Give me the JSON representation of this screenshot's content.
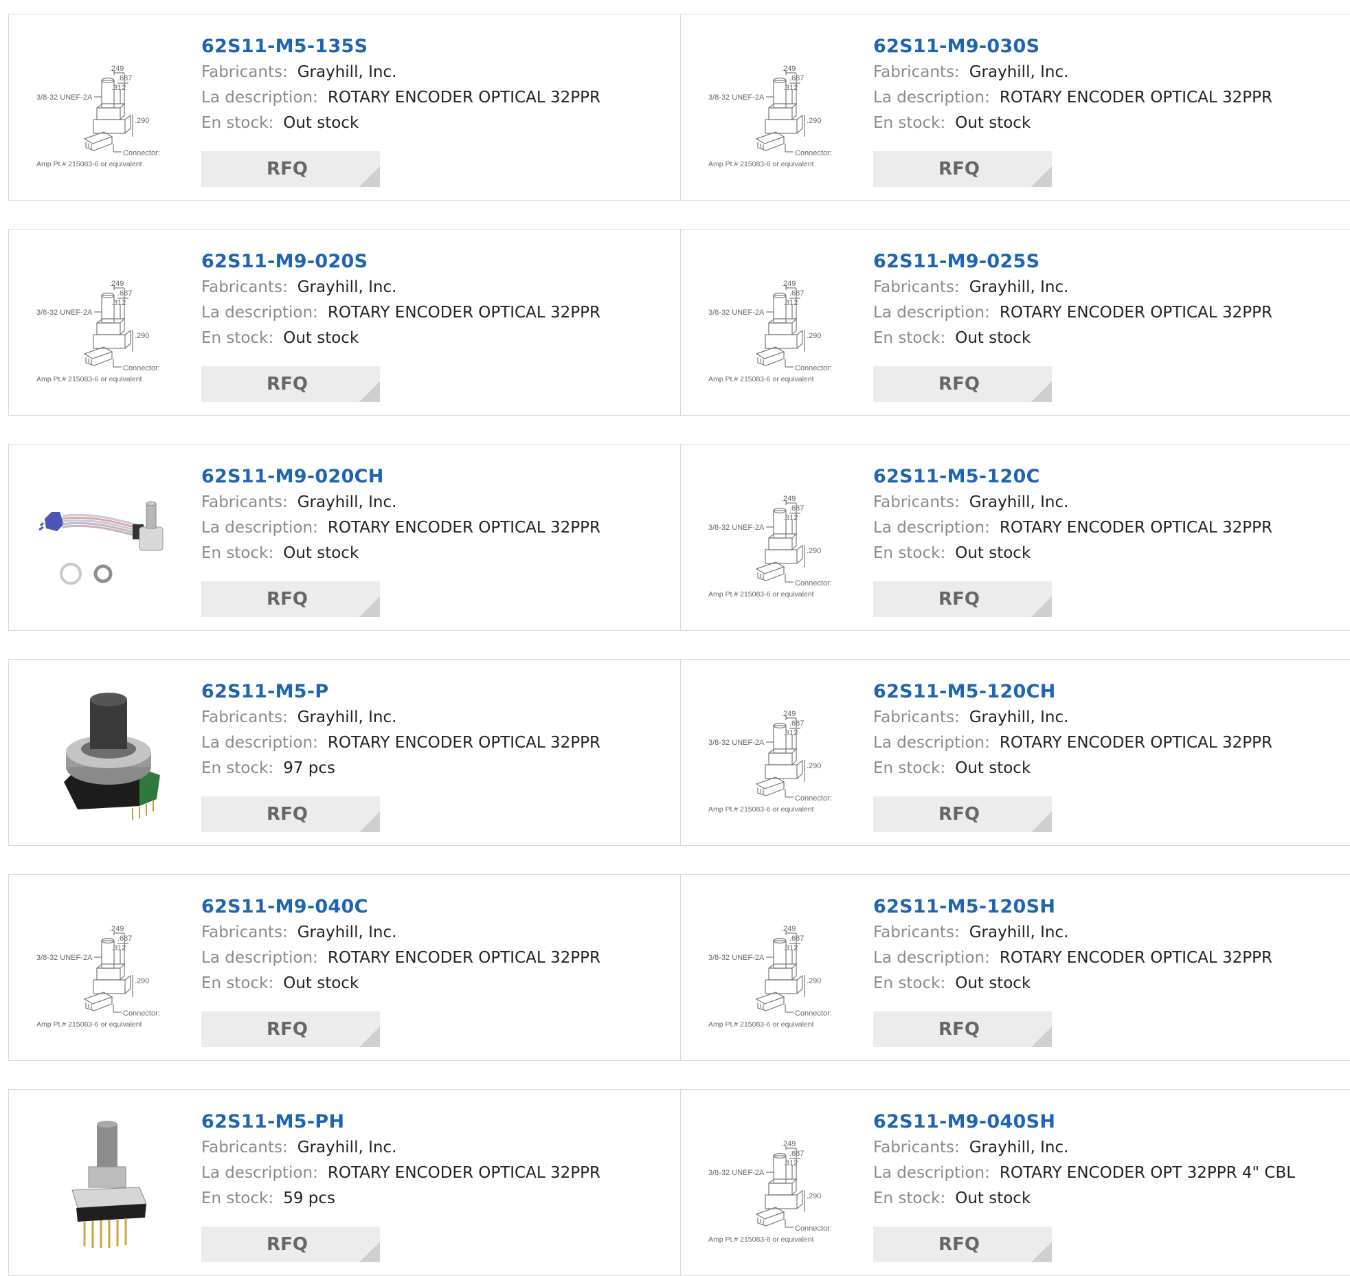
{
  "labels": {
    "manufacturer": "Fabricants:",
    "description": "La description:",
    "stock": "En stock:",
    "rfq": "RFQ"
  },
  "colors": {
    "link": "#1e64b4",
    "label": "#8a8a8a",
    "button_bg": "#ececec",
    "border": "#d9d9d9"
  },
  "drawing_text": [
    "3/8-32 UNEF-2A",
    ".249",
    ".687",
    ".312",
    ".290",
    "Connector:",
    "Amp Pt.# 215083-6 or equivalent"
  ],
  "products": [
    {
      "part": "62S11-M5-135S",
      "manufacturer": "Grayhill, Inc.",
      "description": "ROTARY ENCODER OPTICAL 32PPR",
      "stock": "Out stock",
      "image": "dimension-drawing"
    },
    {
      "part": "62S11-M9-030S",
      "manufacturer": "Grayhill, Inc.",
      "description": "ROTARY ENCODER OPTICAL 32PPR",
      "stock": "Out stock",
      "image": "dimension-drawing"
    },
    {
      "part": "62S11-M9-020S",
      "manufacturer": "Grayhill, Inc.",
      "description": "ROTARY ENCODER OPTICAL 32PPR",
      "stock": "Out stock",
      "image": "dimension-drawing"
    },
    {
      "part": "62S11-M9-025S",
      "manufacturer": "Grayhill, Inc.",
      "description": "ROTARY ENCODER OPTICAL 32PPR",
      "stock": "Out stock",
      "image": "dimension-drawing"
    },
    {
      "part": "62S11-M9-020CH",
      "manufacturer": "Grayhill, Inc.",
      "description": "ROTARY ENCODER OPTICAL 32PPR",
      "stock": "Out stock",
      "image": "encoder-with-ribbon-cable"
    },
    {
      "part": "62S11-M5-120C",
      "manufacturer": "Grayhill, Inc.",
      "description": "ROTARY ENCODER OPTICAL 32PPR",
      "stock": "Out stock",
      "image": "dimension-drawing"
    },
    {
      "part": "62S11-M5-P",
      "manufacturer": "Grayhill, Inc.",
      "description": "ROTARY ENCODER OPTICAL 32PPR",
      "stock": "97 pcs",
      "image": "encoder-photo-knob"
    },
    {
      "part": "62S11-M5-120CH",
      "manufacturer": "Grayhill, Inc.",
      "description": "ROTARY ENCODER OPTICAL 32PPR",
      "stock": "Out stock",
      "image": "dimension-drawing"
    },
    {
      "part": "62S11-M9-040C",
      "manufacturer": "Grayhill, Inc.",
      "description": "ROTARY ENCODER OPTICAL 32PPR",
      "stock": "Out stock",
      "image": "dimension-drawing"
    },
    {
      "part": "62S11-M5-120SH",
      "manufacturer": "Grayhill, Inc.",
      "description": "ROTARY ENCODER OPTICAL 32PPR",
      "stock": "Out stock",
      "image": "dimension-drawing"
    },
    {
      "part": "62S11-M5-PH",
      "manufacturer": "Grayhill, Inc.",
      "description": "ROTARY ENCODER OPTICAL 32PPR",
      "stock": "59 pcs",
      "image": "encoder-photo-pins"
    },
    {
      "part": "62S11-M9-040SH",
      "manufacturer": "Grayhill, Inc.",
      "description": "ROTARY ENCODER OPT 32PPR 4\" CBL",
      "stock": "Out stock",
      "image": "dimension-drawing"
    }
  ]
}
